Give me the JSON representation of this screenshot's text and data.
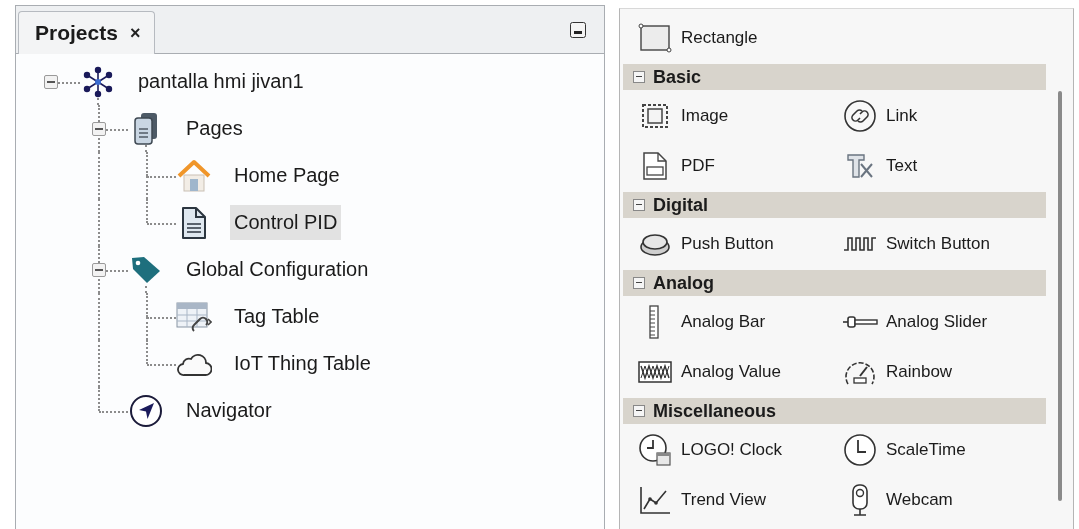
{
  "projects_panel": {
    "tab": {
      "label": "Projects",
      "close": "×",
      "selected": true
    },
    "tree": [
      {
        "label": "pantalla hmi jivan1",
        "expanded": true,
        "selected": false,
        "children": [
          {
            "label": "Pages",
            "expanded": true,
            "selected": false,
            "children": [
              {
                "label": "Home Page",
                "selected": false
              },
              {
                "label": "Control  PID",
                "selected": true
              }
            ]
          },
          {
            "label": "Global Configuration",
            "expanded": true,
            "selected": false,
            "children": [
              {
                "label": "Tag Table",
                "selected": false
              },
              {
                "label": "IoT Thing Table",
                "selected": false
              }
            ]
          },
          {
            "label": "Navigator",
            "selected": false
          }
        ]
      }
    ]
  },
  "toolbox": {
    "sections": [
      {
        "items": [
          {
            "label": "Rectangle"
          }
        ]
      },
      {
        "title": "Basic",
        "expanded": true,
        "items": [
          {
            "label": "Image"
          },
          {
            "label": "Link"
          },
          {
            "label": "PDF"
          },
          {
            "label": "Text"
          }
        ]
      },
      {
        "title": "Digital",
        "expanded": true,
        "items": [
          {
            "label": "Push Button"
          },
          {
            "label": "Switch Button"
          }
        ]
      },
      {
        "title": "Analog",
        "expanded": true,
        "items": [
          {
            "label": "Analog Bar"
          },
          {
            "label": "Analog Slider"
          },
          {
            "label": "Analog Value"
          },
          {
            "label": "Rainbow"
          }
        ]
      },
      {
        "title": "Miscellaneous",
        "expanded": true,
        "items": [
          {
            "label": "LOGO! Clock"
          },
          {
            "label": "ScaleTime"
          },
          {
            "label": "Trend View"
          },
          {
            "label": "Webcam"
          }
        ]
      }
    ]
  }
}
